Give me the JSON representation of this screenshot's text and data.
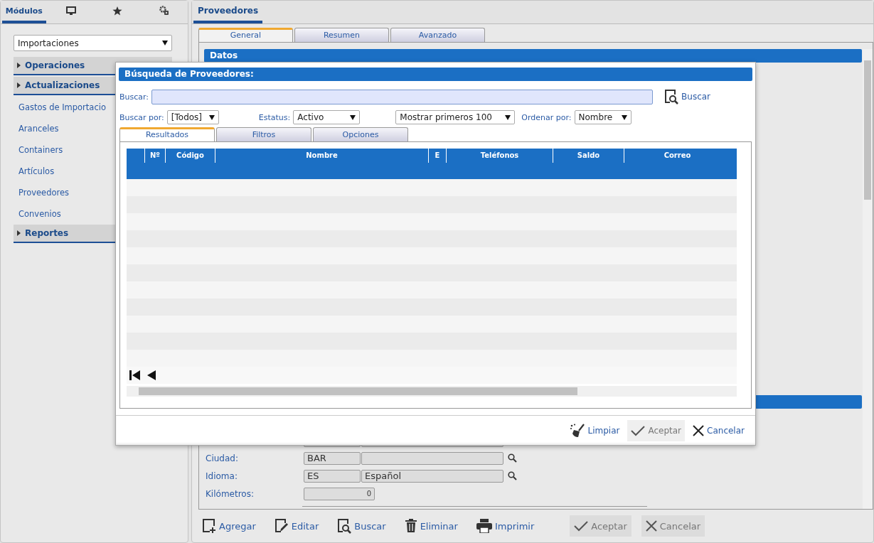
{
  "sidebar": {
    "tabs": [
      {
        "kind": "text",
        "label": "Módulos",
        "selected": true
      },
      {
        "kind": "monitor",
        "selected": false
      },
      {
        "kind": "star",
        "selected": false
      },
      {
        "kind": "gears",
        "selected": false
      }
    ],
    "module_select": "Importaciones",
    "menu": [
      {
        "kind": "group",
        "label": "Operaciones"
      },
      {
        "kind": "group",
        "label": "Actualizaciones"
      },
      {
        "kind": "item",
        "label": "Gastos de Importacio"
      },
      {
        "kind": "item",
        "label": "Aranceles"
      },
      {
        "kind": "item",
        "label": "Containers"
      },
      {
        "kind": "item",
        "label": "Artículos"
      },
      {
        "kind": "item",
        "label": "Proveedores"
      },
      {
        "kind": "item",
        "label": "Convenios"
      },
      {
        "kind": "group",
        "label": "Reportes"
      }
    ]
  },
  "main": {
    "tab": "Proveedores",
    "subtabs": [
      {
        "label": "General",
        "selected": true
      },
      {
        "label": "Resumen",
        "selected": false
      },
      {
        "label": "Avanzado",
        "selected": false
      }
    ],
    "section": "Datos",
    "form": [
      {
        "kind": "lookup",
        "label": "Ciudad:",
        "code": "BAR"
      },
      {
        "kind": "lookup",
        "label": "Idioma:",
        "code": "ES",
        "name": "Español"
      },
      {
        "kind": "number",
        "label": "Kilómetros:",
        "value": "0"
      }
    ],
    "toolbar": [
      {
        "kind": "add",
        "label": "Agregar",
        "disabled": false
      },
      {
        "kind": "edit",
        "label": "Editar",
        "disabled": false
      },
      {
        "kind": "search",
        "label": "Buscar",
        "disabled": false
      },
      {
        "kind": "delete",
        "label": "Eliminar",
        "disabled": false
      },
      {
        "kind": "print",
        "label": "Imprimir",
        "disabled": false
      },
      {
        "kind": "accept",
        "label": "Aceptar",
        "disabled": true
      },
      {
        "kind": "cancel",
        "label": "Cancelar",
        "disabled": true
      }
    ]
  },
  "dialog": {
    "title": "Búsqueda de Proveedores:",
    "search_label": "Buscar:",
    "search_button": "Buscar",
    "filters": [
      {
        "label": "Buscar por:",
        "value": "[Todos]"
      },
      {
        "label": "Estatus:",
        "value": "Activo"
      },
      {
        "value": "Mostrar primeros 100"
      },
      {
        "label": "Ordenar por:",
        "value": "Nombre"
      }
    ],
    "tabs": [
      {
        "label": "Resultados",
        "selected": true
      },
      {
        "label": "Filtros",
        "selected": false
      },
      {
        "label": "Opciones",
        "selected": false
      }
    ],
    "columns": [
      "Nº",
      "Código",
      "Nombre",
      "E",
      "Teléfonos",
      "Saldo",
      "Correo"
    ],
    "footer": [
      {
        "kind": "clear",
        "label": "Limpiar",
        "disabled": false
      },
      {
        "kind": "accept",
        "label": "Aceptar",
        "disabled": true
      },
      {
        "kind": "cancel",
        "label": "Cancelar",
        "disabled": false
      }
    ]
  }
}
